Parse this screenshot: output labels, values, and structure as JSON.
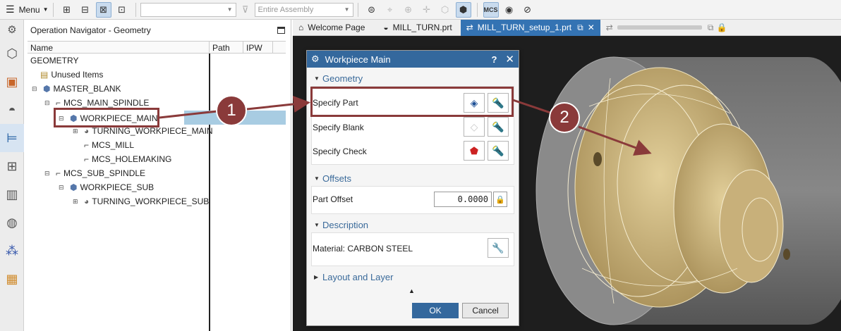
{
  "toolbar": {
    "menu_label": "Menu",
    "filter_select_value": "",
    "assembly_select_value": "Entire Assembly"
  },
  "navigator": {
    "title": "Operation Navigator - Geometry",
    "columns": [
      "Name",
      "Path",
      "IPW"
    ],
    "tree": [
      {
        "label": "GEOMETRY",
        "icon": "none"
      },
      {
        "label": "Unused Items",
        "icon": "folder-icon"
      },
      {
        "label": "MASTER_BLANK",
        "icon": "workpiece-icon"
      },
      {
        "label": "MCS_MAIN_SPINDLE",
        "icon": "mcs-icon"
      },
      {
        "label": "WORKPIECE_MAIN",
        "icon": "workpiece-icon",
        "selected": true
      },
      {
        "label": "TURNING_WORKPIECE_MAIN",
        "icon": "turning-workpiece-icon"
      },
      {
        "label": "MCS_MILL",
        "icon": "mcs-icon"
      },
      {
        "label": "MCS_HOLEMAKING",
        "icon": "mcs-icon"
      },
      {
        "label": "MCS_SUB_SPINDLE",
        "icon": "mcs-icon"
      },
      {
        "label": "WORKPIECE_SUB",
        "icon": "workpiece-icon"
      },
      {
        "label": "TURNING_WORKPIECE_SUB",
        "icon": "turning-workpiece-icon"
      }
    ]
  },
  "tabs": [
    {
      "label": "Welcome Page"
    },
    {
      "label": "MILL_TURN.prt"
    },
    {
      "label": "MILL_TURN_setup_1.prt",
      "active": true
    }
  ],
  "dialog": {
    "title": "Workpiece Main",
    "help": "?",
    "sections": {
      "geometry": "Geometry",
      "offsets": "Offsets",
      "description": "Description",
      "layout": "Layout and Layer"
    },
    "specify_part": "Specify Part",
    "specify_blank": "Specify Blank",
    "specify_check": "Specify Check",
    "part_offset_label": "Part Offset",
    "part_offset_value": "0.0000",
    "material": "Material: CARBON STEEL",
    "ok": "OK",
    "cancel": "Cancel"
  },
  "callouts": [
    "1",
    "2"
  ],
  "colors": {
    "accent": "#34689d",
    "callout": "#8a3a3a",
    "active_tab": "#3473b3",
    "part_wire": "#c9b27a"
  }
}
